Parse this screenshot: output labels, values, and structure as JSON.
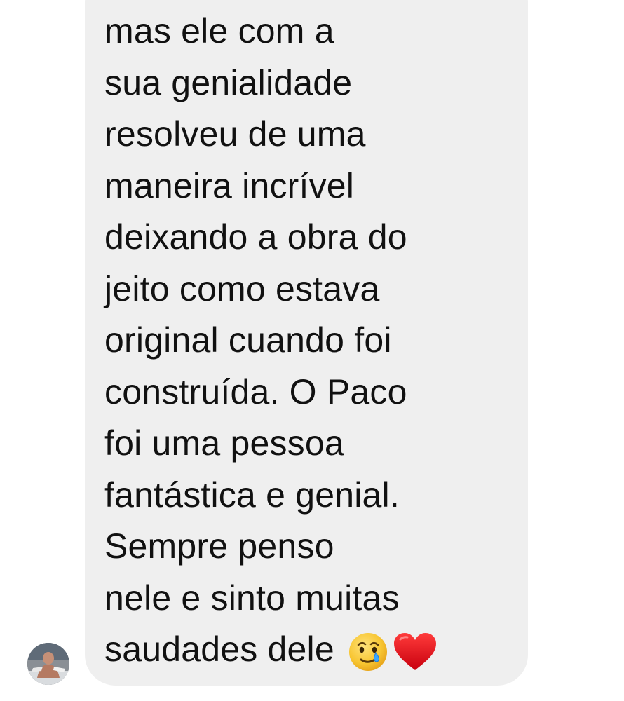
{
  "conversation": {
    "message": {
      "lines": [
        "mas ele com a",
        "sua genialidade",
        "resolveu de uma",
        "maneira incrível",
        "deixando a obra do",
        "jeito como estava",
        "original cuando foi",
        "construída. O Paco",
        "foi uma pessoa",
        "fantástica e genial.",
        "Sempre penso",
        "nele e sinto muitas",
        "saudades dele"
      ],
      "emojis": [
        "smiling-face-with-tear",
        "red-heart"
      ]
    },
    "sender_avatar": {
      "icon": "profile-photo"
    }
  },
  "colors": {
    "bubble": "#efefef",
    "text": "#111111",
    "background": "#ffffff",
    "heart": "#e0101d",
    "emoji_face": "#f7c531"
  }
}
